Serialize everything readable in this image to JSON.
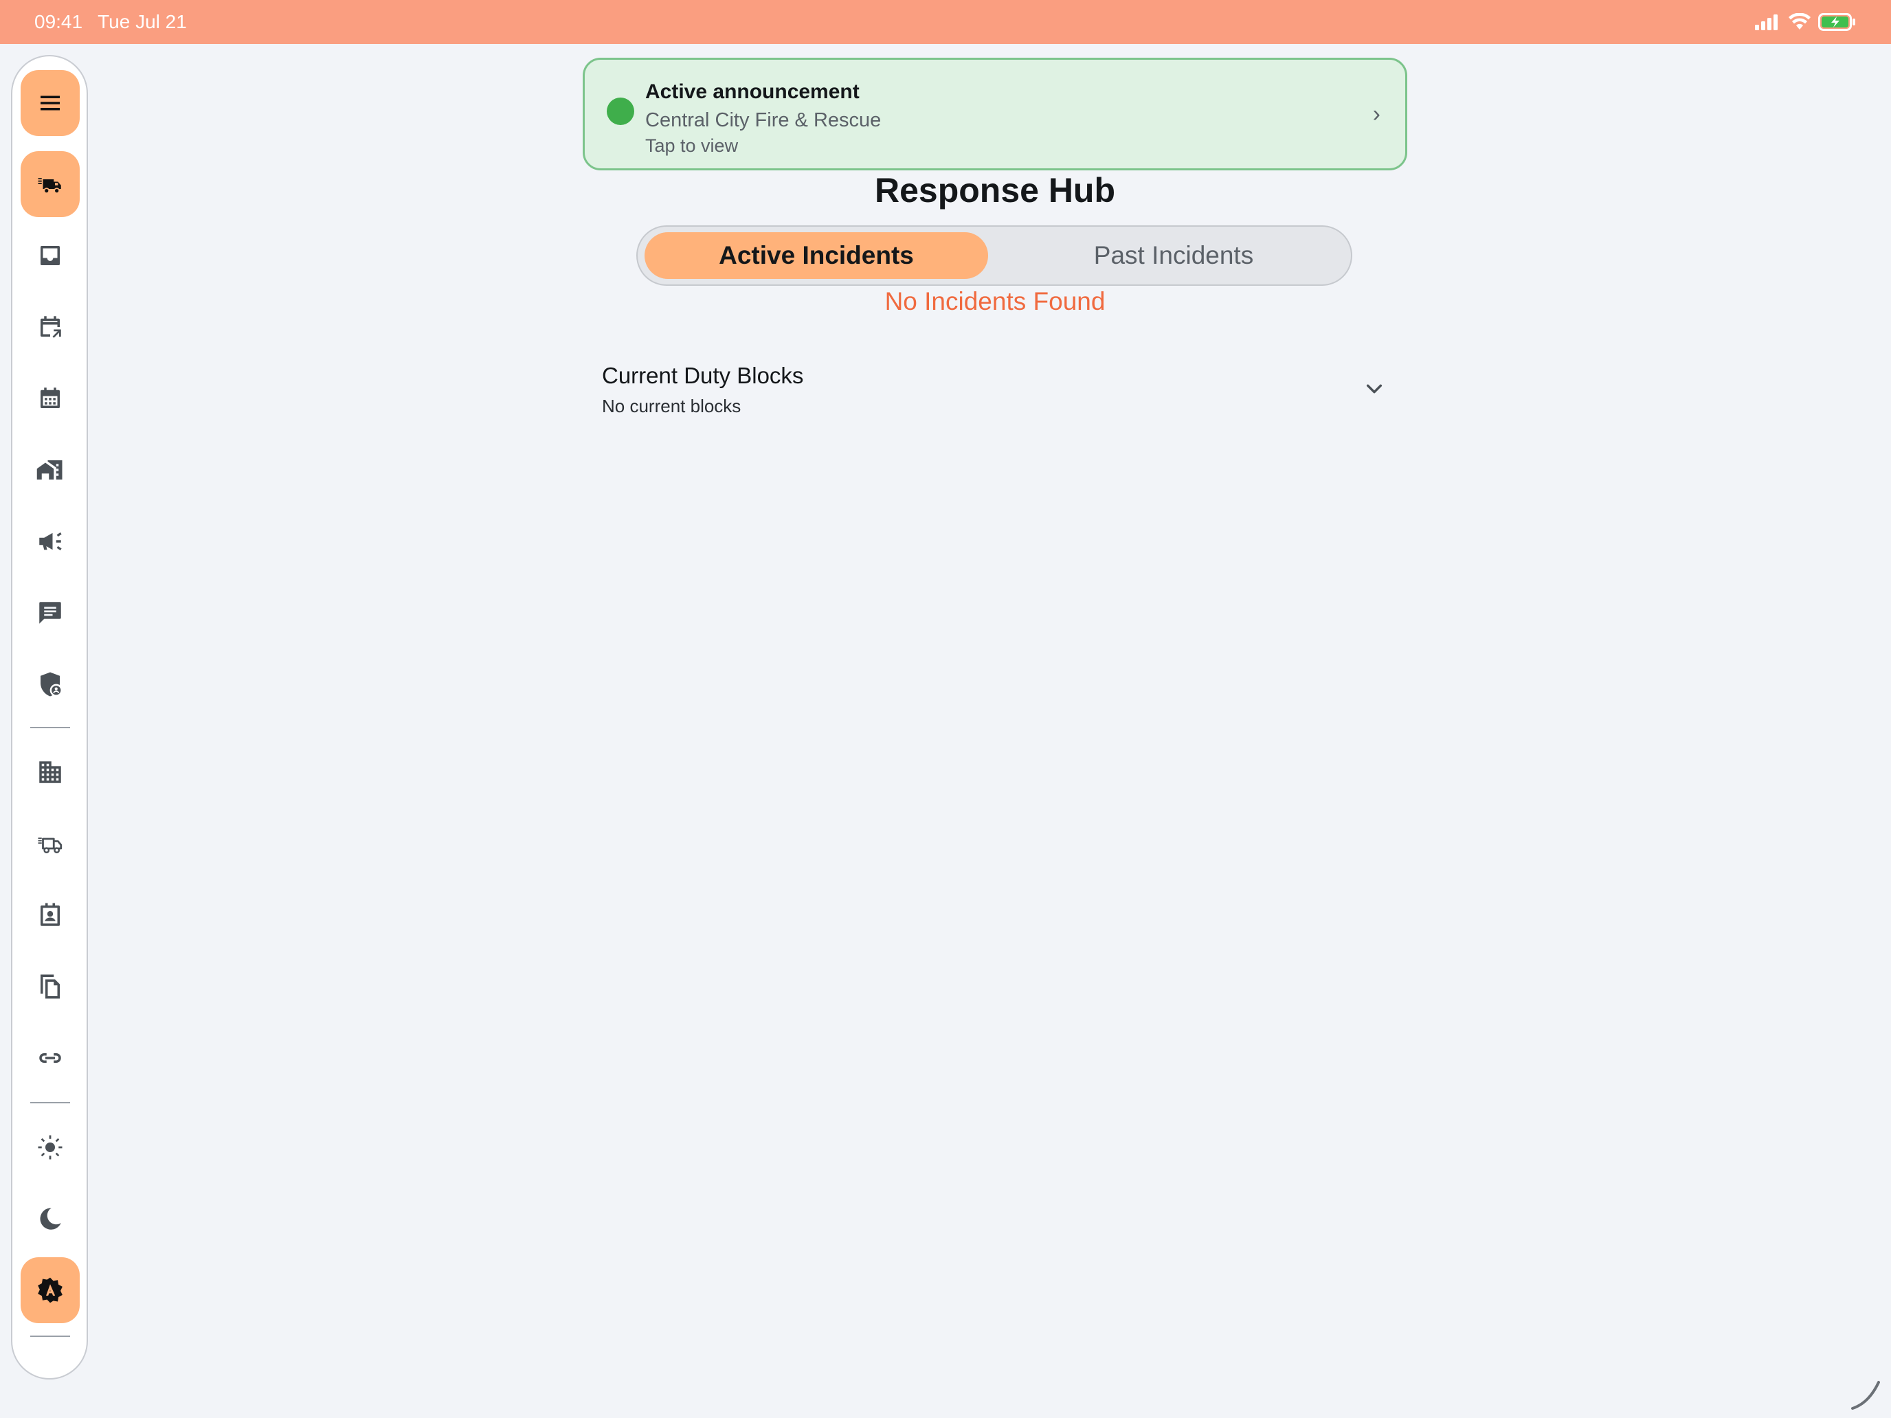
{
  "status_bar": {
    "time": "09:41",
    "date": "Tue Jul 21"
  },
  "sidebar": {
    "items": [
      {
        "id": "menu",
        "icon": "hamburger-menu-icon",
        "accent": true
      },
      {
        "id": "incidents",
        "icon": "fire-truck-icon",
        "accent": true
      },
      {
        "id": "inbox",
        "icon": "inbox-icon"
      },
      {
        "id": "schedule-share",
        "icon": "calendar-arrow-icon"
      },
      {
        "id": "calendar",
        "icon": "calendar-icon"
      },
      {
        "id": "stations",
        "icon": "home-work-icon"
      },
      {
        "id": "announcements",
        "icon": "megaphone-icon"
      },
      {
        "id": "messages",
        "icon": "chat-icon"
      },
      {
        "id": "admin",
        "icon": "shield-person-icon"
      },
      {
        "id": "organizations",
        "icon": "building-icon"
      },
      {
        "id": "apparatus",
        "icon": "fire-truck-outline-icon"
      },
      {
        "id": "contacts",
        "icon": "contact-card-icon"
      },
      {
        "id": "documents",
        "icon": "documents-icon"
      },
      {
        "id": "links",
        "icon": "link-icon"
      },
      {
        "id": "light-theme",
        "icon": "sun-icon"
      },
      {
        "id": "dark-theme",
        "icon": "moon-icon"
      },
      {
        "id": "auto-theme",
        "icon": "auto-theme-icon",
        "accent": true
      }
    ]
  },
  "announcement": {
    "title": "Active announcement",
    "organization": "Central City Fire & Rescue",
    "hint": "Tap to view",
    "chevron": "›"
  },
  "main": {
    "title": "Response Hub",
    "tabs": [
      {
        "label": "Active Incidents",
        "selected": true
      },
      {
        "label": "Past Incidents",
        "selected": false
      }
    ],
    "empty_message": "No Incidents Found",
    "duty_blocks": {
      "title": "Current Duty Blocks",
      "subtitle": "No current blocks"
    }
  },
  "colors": {
    "status_bar": "#fa9e80",
    "accent": "#ffb27a",
    "announcement_bg": "#dff2e3",
    "announcement_border": "#7cc48b",
    "live_dot": "#3fae4b",
    "empty_text": "#f06a3f",
    "page_bg": "#f2f4f8"
  }
}
